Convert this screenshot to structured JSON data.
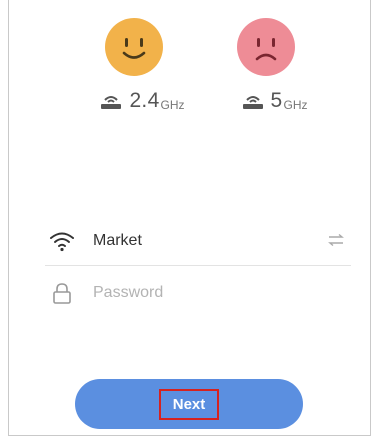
{
  "bands": [
    {
      "mood": "happy",
      "freq": "2.4",
      "unit": "GHz",
      "face_color": "#f2b24a"
    },
    {
      "mood": "sad",
      "freq": "5",
      "unit": "GHz",
      "face_color": "#ee8c96"
    }
  ],
  "wifi": {
    "ssid": "Market",
    "password_placeholder": "Password",
    "password_value": ""
  },
  "actions": {
    "next_label": "Next"
  },
  "colors": {
    "accent": "#5b8fe0",
    "highlight_box": "#d6221f"
  },
  "icons": {
    "band_icon": "router-icon",
    "ssid_icon": "wifi-icon",
    "password_icon": "lock-icon",
    "switch_icon": "switch-network-icon"
  }
}
